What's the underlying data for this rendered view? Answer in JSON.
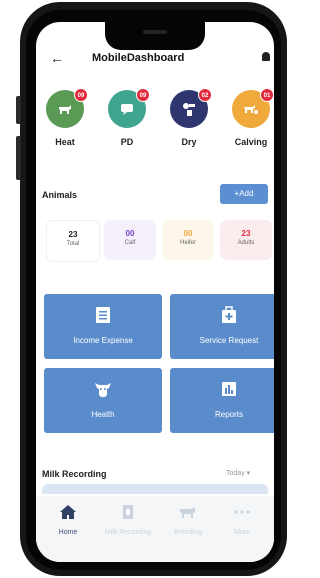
{
  "header": {
    "back_label": "←",
    "title": "MobileDashboard"
  },
  "categories": [
    {
      "label": "Heat",
      "count": "09",
      "color": "#5a9a55",
      "icon": "cow-icon"
    },
    {
      "label": "PD",
      "count": "09",
      "color": "#3fa58f",
      "icon": "message-icon"
    },
    {
      "label": "Dry",
      "count": "02",
      "color": "#2f356f",
      "icon": "milk-icon"
    },
    {
      "label": "Calving",
      "count": "01",
      "color": "#f0a93b",
      "icon": "cow-calf-icon"
    }
  ],
  "animals": {
    "title": "Animals",
    "add_label": "+Add",
    "stats": [
      {
        "value": "23",
        "label": "Total",
        "color": "#222222",
        "bg": "#ffffff"
      },
      {
        "value": "00",
        "label": "Calf",
        "color": "#7a3fc4",
        "bg": "#f5f0fb"
      },
      {
        "value": "00",
        "label": "Heifer",
        "color": "#f0a93b",
        "bg": "#fdf6ea"
      },
      {
        "value": "23",
        "label": "Adults",
        "color": "#e02b3c",
        "bg": "#fbecee"
      }
    ]
  },
  "tiles": [
    {
      "label": "Income Expense",
      "icon": "list-icon"
    },
    {
      "label": "Service Request",
      "icon": "medical-kit-icon"
    },
    {
      "label": "Health",
      "icon": "cow-head-icon"
    },
    {
      "label": "Reports",
      "icon": "bar-chart-icon"
    }
  ],
  "milk": {
    "title": "Milk Recording",
    "filter": "Today ▾"
  },
  "nav": [
    {
      "label": "Home",
      "active": true,
      "icon": "home-icon"
    },
    {
      "label": "Milk Recording",
      "active": false,
      "icon": "milk-doc-icon"
    },
    {
      "label": "Breeding",
      "active": false,
      "icon": "cow-icon"
    },
    {
      "label": "More",
      "active": false,
      "icon": "more-icon"
    }
  ]
}
